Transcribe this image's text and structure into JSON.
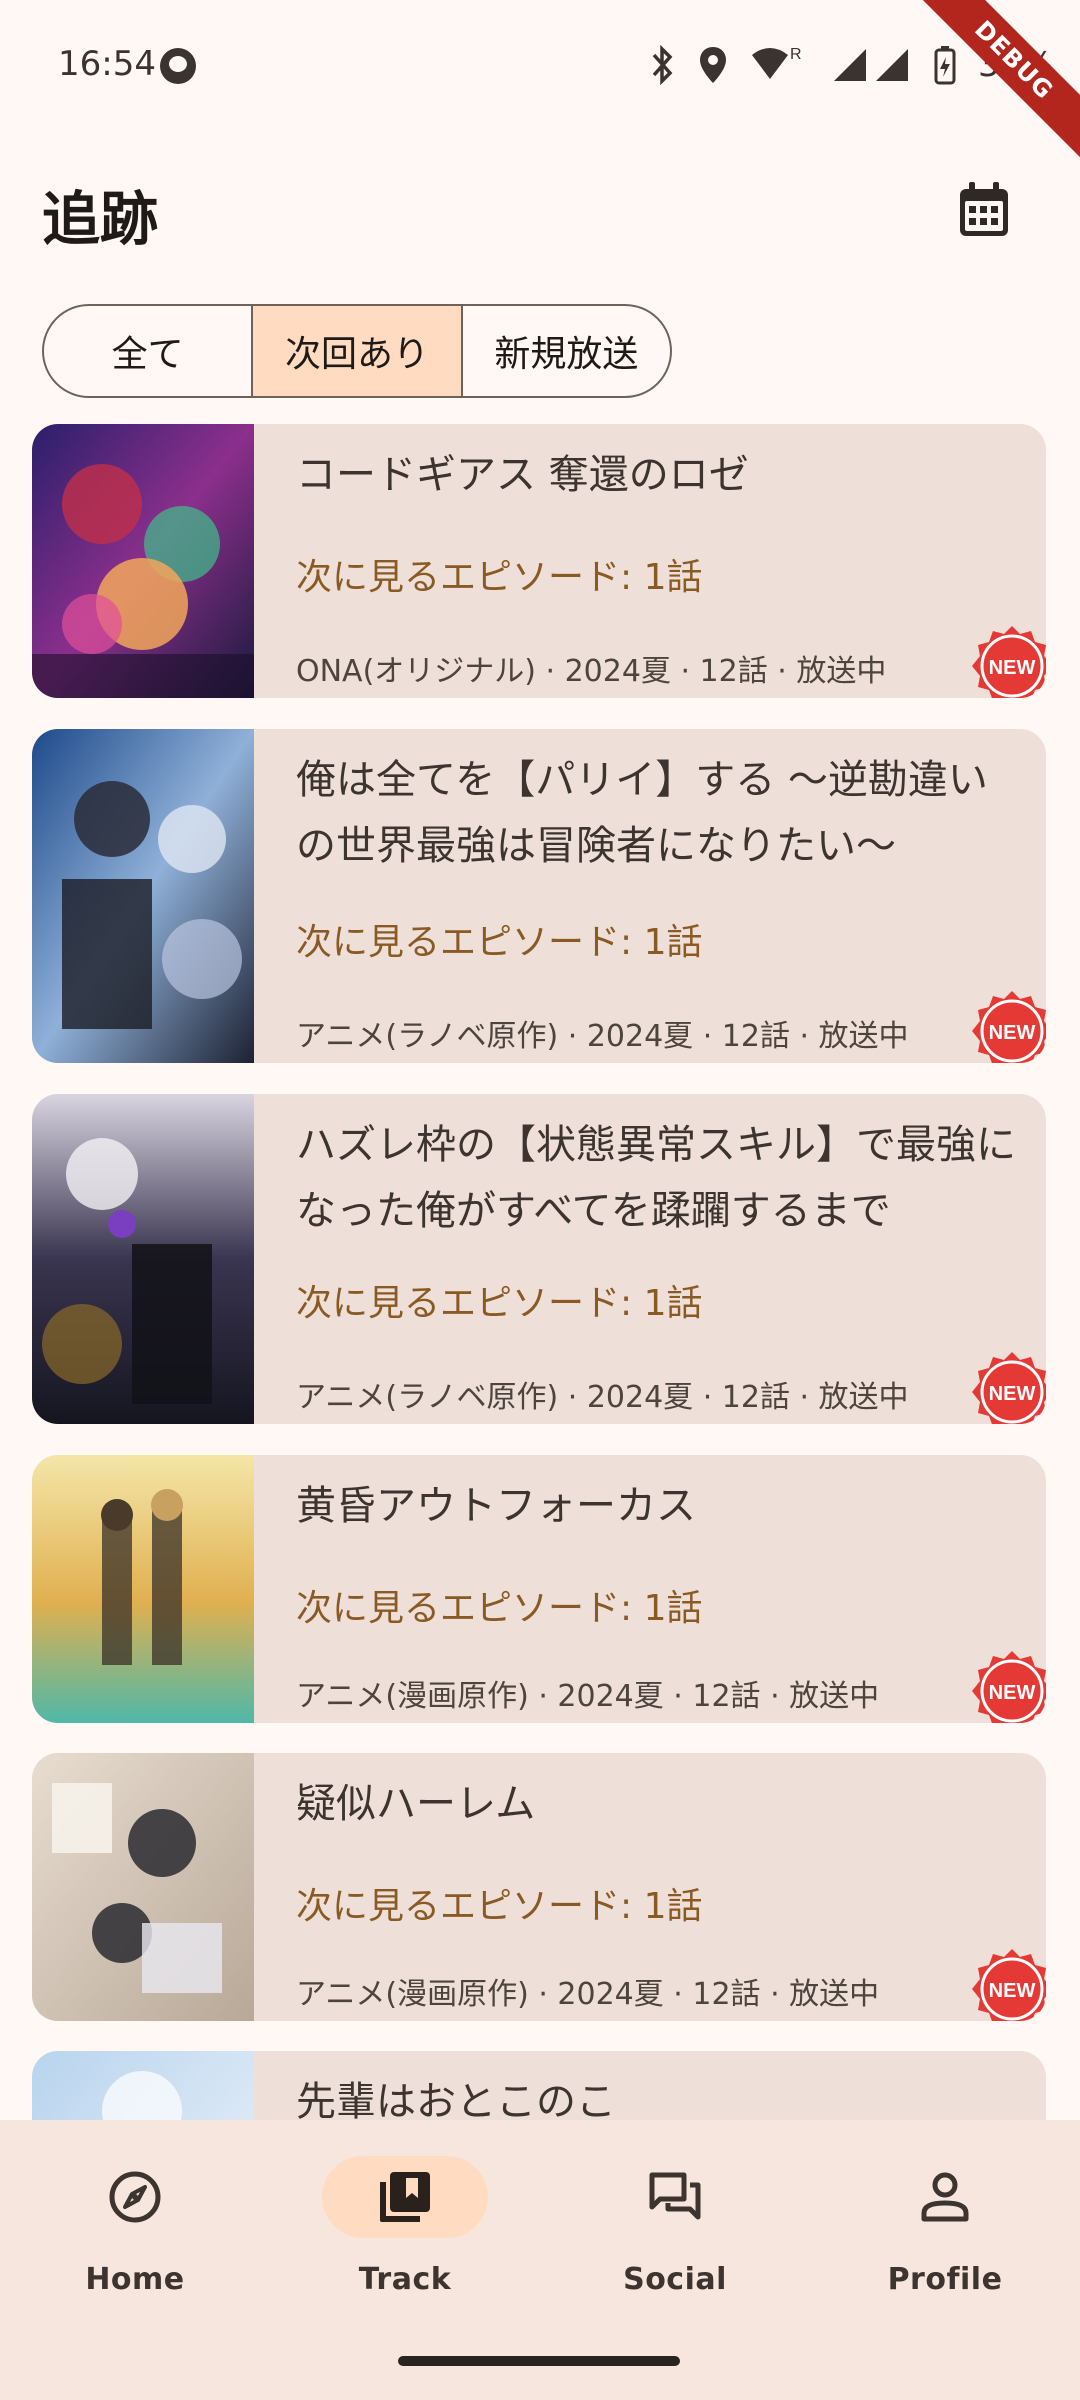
{
  "status_bar": {
    "time": "16:54",
    "battery": "37%",
    "debug_label": "DEBUG"
  },
  "app_bar": {
    "title": "追跡",
    "calendar_icon": "calendar-icon"
  },
  "filter": {
    "options": [
      "全て",
      "次回あり",
      "新規放送"
    ],
    "selected": "次回あり"
  },
  "anime_list": [
    {
      "title": "コードギアス 奪還のロゼ",
      "next_episode": "次に見るエピソード: 1話",
      "meta": "ONA(オリジナル) · 2024夏 · 12話 · 放送中",
      "badge": "NEW"
    },
    {
      "title": "俺は全てを【パリイ】する ～逆勘違いの世界最強は冒険者になりたい～",
      "next_episode": "次に見るエピソード: 1話",
      "meta": "アニメ(ラノベ原作) · 2024夏 · 12話 · 放送中",
      "badge": "NEW"
    },
    {
      "title": "ハズレ枠の【状態異常スキル】で最強になった俺がすべてを蹂躙するまで",
      "next_episode": "次に見るエピソード: 1話",
      "meta": "アニメ(ラノベ原作) · 2024夏 · 12話 · 放送中",
      "badge": "NEW"
    },
    {
      "title": "黄昏アウトフォーカス",
      "next_episode": "次に見るエピソード: 1話",
      "meta": "アニメ(漫画原作) · 2024夏 · 12話 · 放送中",
      "badge": "NEW"
    },
    {
      "title": "疑似ハーレム",
      "next_episode": "次に見るエピソード: 1話",
      "meta": "アニメ(漫画原作) · 2024夏 · 12話 · 放送中",
      "badge": "NEW"
    },
    {
      "title": "先輩はおとこのこ"
    }
  ],
  "bottom_nav": [
    {
      "label": "Home",
      "icon": "compass-icon",
      "active": false
    },
    {
      "label": "Track",
      "icon": "library-icon",
      "active": true
    },
    {
      "label": "Social",
      "icon": "forum-icon",
      "active": false
    },
    {
      "label": "Profile",
      "icon": "person-icon",
      "active": false
    }
  ]
}
